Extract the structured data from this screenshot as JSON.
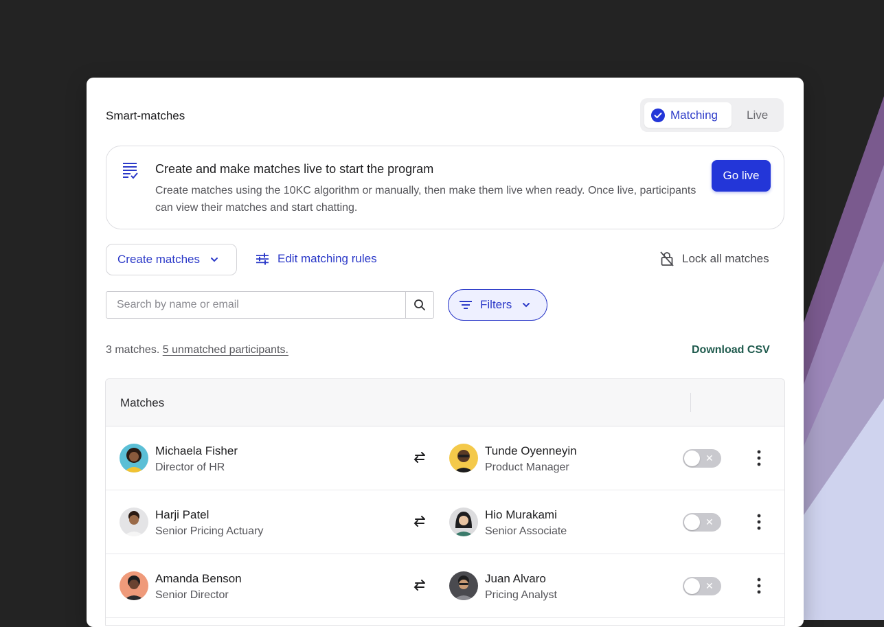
{
  "header": {
    "title": "Smart-matches",
    "segmented": {
      "active_label": "Matching",
      "inactive_label": "Live"
    }
  },
  "banner": {
    "icon": "checklist-icon",
    "title": "Create and make matches live to start the program",
    "description": "Create matches using the 10KC algorithm or manually, then make them live when ready. Once live, participants can view their matches and start chatting.",
    "button_label": "Go live"
  },
  "toolbar": {
    "create_label": "Create matches",
    "edit_rules_label": "Edit matching rules",
    "lock_all_label": "Lock all matches"
  },
  "search": {
    "placeholder": "Search by name or email",
    "value": ""
  },
  "filters": {
    "label": "Filters"
  },
  "summary": {
    "count_text": "3 matches.",
    "unmatched_link": "5 unmatched participants.",
    "download_label": "Download CSV"
  },
  "table": {
    "header": "Matches",
    "rows": [
      {
        "left": {
          "name": "Michaela Fisher",
          "role": "Director of HR",
          "avatar_bg": "#5bbfd6"
        },
        "right": {
          "name": "Tunde Oyenneyin",
          "role": "Product Manager",
          "avatar_bg": "#f4c94a"
        },
        "live": false
      },
      {
        "left": {
          "name": "Harji Patel",
          "role": "Senior Pricing Actuary",
          "avatar_bg": "#e4e4e6"
        },
        "right": {
          "name": "Hio Murakami",
          "role": "Senior Associate",
          "avatar_bg": "#dcdcde"
        },
        "live": false
      },
      {
        "left": {
          "name": "Amanda Benson",
          "role": "Senior Director",
          "avatar_bg": "#ef9a7a"
        },
        "right": {
          "name": "Juan Alvaro",
          "role": "Pricing Analyst",
          "avatar_bg": "#4a4a4f"
        },
        "live": false
      }
    ]
  },
  "colors": {
    "accent": "#2b39c8",
    "primary_button": "#2336d8",
    "download_link": "#1f5a4d",
    "page_background": "#232323"
  }
}
